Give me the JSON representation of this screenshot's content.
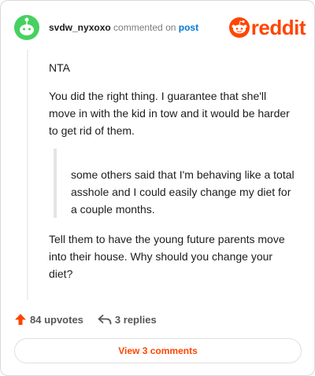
{
  "header": {
    "username": "svdw_nyxoxo",
    "action_text": " commented on ",
    "post_link": "post",
    "brand_text": "reddit"
  },
  "comment": {
    "paragraph1": "NTA",
    "paragraph2": "You did the right thing. I guarantee that she'll move in with the kid in tow and it would be harder to get rid of them.",
    "quote": "some others said that I'm behaving like a total asshole and I could easily change my diet for a couple months.",
    "paragraph3": "Tell them to have the young future parents move into their house. Why should you change your diet?"
  },
  "footer": {
    "upvotes_label": "84 upvotes",
    "replies_label": "3 replies",
    "view_comments_label": "View 3 comments"
  },
  "colors": {
    "brand": "#ff4500",
    "avatar": "#46d160",
    "link": "#0079d3"
  }
}
